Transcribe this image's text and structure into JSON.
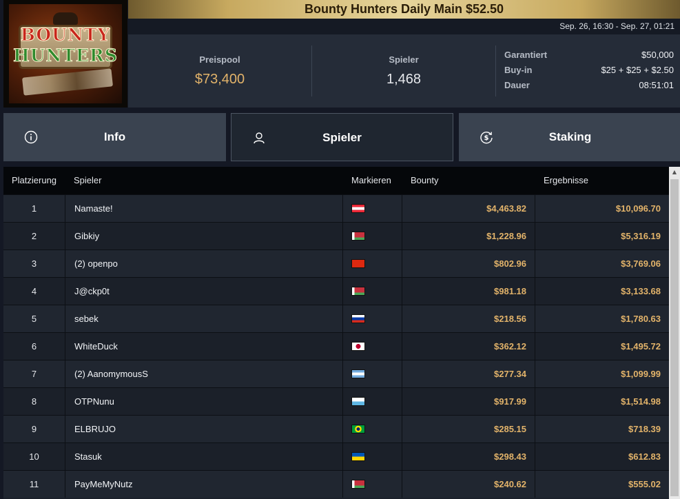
{
  "logo": {
    "line1": "BOUNTY",
    "line2": "HUNTERS"
  },
  "header": {
    "title": "Bounty Hunters Daily Main $52.50",
    "dates": "Sep. 26, 16:30 - Sep. 27, 01:21"
  },
  "stats": {
    "prizepool_label": "Preispool",
    "prizepool_value": "$73,400",
    "players_label": "Spieler",
    "players_value": "1,468"
  },
  "details": [
    {
      "label": "Garantiert",
      "value": "$50,000"
    },
    {
      "label": "Buy-in",
      "value": "$25 + $25 + $2.50"
    },
    {
      "label": "Dauer",
      "value": "08:51:01"
    }
  ],
  "tabs": [
    {
      "label": "Info",
      "icon": "info-icon"
    },
    {
      "label": "Spieler",
      "icon": "user-icon"
    },
    {
      "label": "Staking",
      "icon": "dollar-refresh-icon"
    }
  ],
  "table": {
    "headers": [
      "Platzierung",
      "Spieler",
      "Markieren",
      "Bounty",
      "Ergebnisse"
    ],
    "rows": [
      {
        "rank": "1",
        "player": "Namaste!",
        "flag": "austria",
        "bounty": "$4,463.82",
        "result": "$10,096.70"
      },
      {
        "rank": "2",
        "player": "Gibkiy",
        "flag": "belarus",
        "bounty": "$1,228.96",
        "result": "$5,316.19"
      },
      {
        "rank": "3",
        "player": "(2) openpo",
        "flag": "china",
        "bounty": "$802.96",
        "result": "$3,769.06"
      },
      {
        "rank": "4",
        "player": "J@ckp0t",
        "flag": "belarus",
        "bounty": "$981.18",
        "result": "$3,133.68"
      },
      {
        "rank": "5",
        "player": "sebek",
        "flag": "russia",
        "bounty": "$218.56",
        "result": "$1,780.63"
      },
      {
        "rank": "6",
        "player": "WhiteDuck",
        "flag": "japan",
        "bounty": "$362.12",
        "result": "$1,495.72"
      },
      {
        "rank": "7",
        "player": "(2) AanomymousS",
        "flag": "argentina",
        "bounty": "$277.34",
        "result": "$1,099.99"
      },
      {
        "rank": "8",
        "player": "OTPNunu",
        "flag": "san-marino",
        "bounty": "$917.99",
        "result": "$1,514.98"
      },
      {
        "rank": "9",
        "player": "ELBRUJO",
        "flag": "brazil",
        "bounty": "$285.15",
        "result": "$718.39"
      },
      {
        "rank": "10",
        "player": "Stasuk",
        "flag": "ukraine",
        "bounty": "$298.43",
        "result": "$612.83"
      },
      {
        "rank": "11",
        "player": "PayMeMyNutz",
        "flag": "belarus",
        "bounty": "$240.62",
        "result": "$555.02"
      }
    ]
  },
  "colors": {
    "gold": "#e2b36a",
    "panel": "#252c38",
    "active_tab": "#1f2630"
  }
}
